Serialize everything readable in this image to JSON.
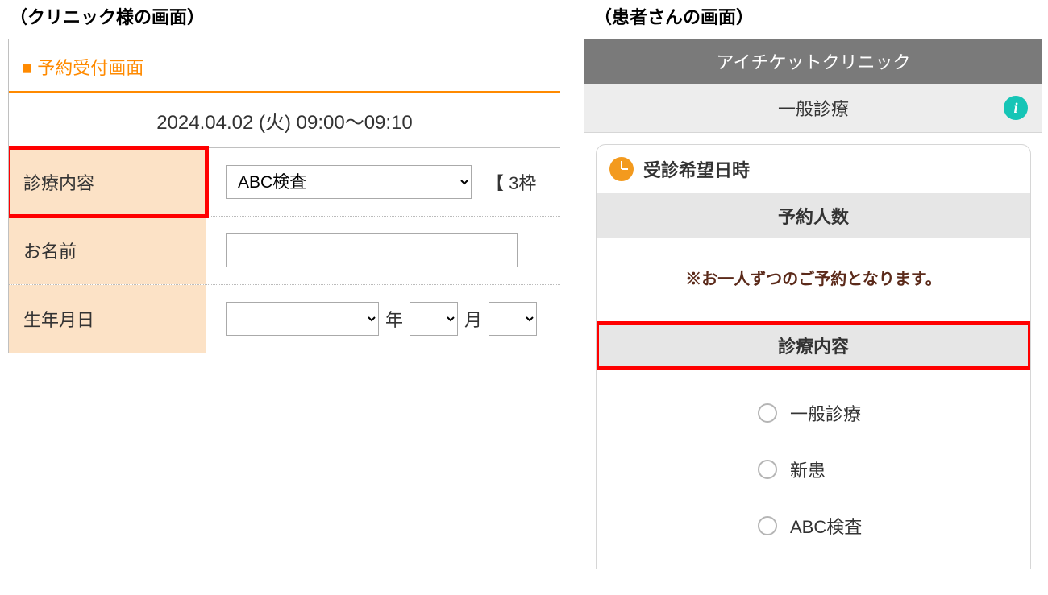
{
  "clinic": {
    "panel_title": "（クリニック様の画面）",
    "screen_title": "予約受付画面",
    "datetime": "2024.04.02 (火)  09:00〜09:10",
    "rows": {
      "content": {
        "label": "診療内容",
        "value": "ABC検査",
        "slots_text": "【 3枠"
      },
      "name": {
        "label": "お名前",
        "value": ""
      },
      "birth": {
        "label": "生年月日",
        "year_suffix": "年",
        "month_suffix": "月"
      }
    }
  },
  "patient": {
    "panel_title": "（患者さんの画面）",
    "header": "アイチケットクリニック",
    "subheader": "一般診療",
    "section_title": "受診希望日時",
    "count_title": "予約人数",
    "note": "※お一人ずつのご予約となります。",
    "content_title": "診療内容",
    "options": [
      "一般診療",
      "新患",
      "ABC検査"
    ]
  }
}
